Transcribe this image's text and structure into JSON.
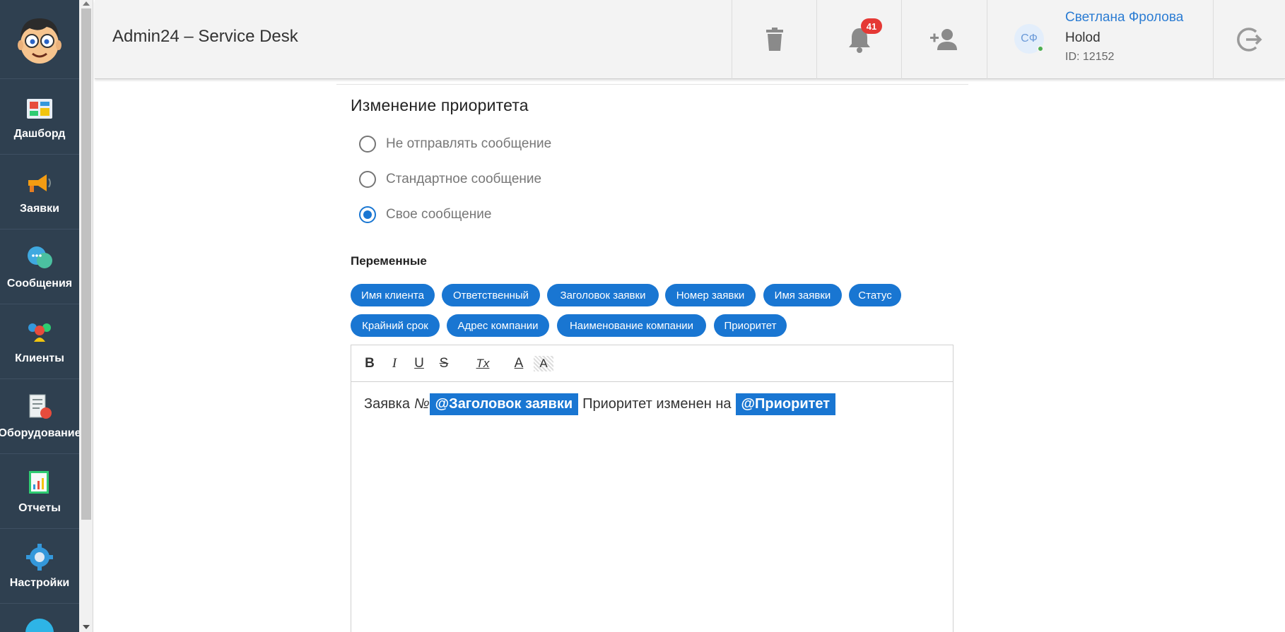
{
  "header": {
    "app_title": "Admin24 – Service Desk",
    "notification_count": "41",
    "user": {
      "initials": "СФ",
      "name": "Светлана Фролова",
      "org": "Holod",
      "id": "ID: 12152"
    }
  },
  "sidebar": {
    "items": [
      {
        "label": "Дашборд",
        "icon": "dashboard-icon"
      },
      {
        "label": "Заявки",
        "icon": "megaphone-icon"
      },
      {
        "label": "Сообщения",
        "icon": "chat-icon"
      },
      {
        "label": "Клиенты",
        "icon": "clients-icon"
      },
      {
        "label": "Оборудование",
        "icon": "equipment-icon"
      },
      {
        "label": "Отчеты",
        "icon": "reports-icon"
      },
      {
        "label": "Настройки",
        "icon": "settings-icon"
      }
    ]
  },
  "main": {
    "section_title": "Изменение приоритета",
    "radios": [
      {
        "label": "Не отправлять сообщение",
        "checked": false
      },
      {
        "label": "Стандартное сообщение",
        "checked": false
      },
      {
        "label": "Свое сообщение",
        "checked": true
      }
    ],
    "variables_title": "Переменные",
    "variables": [
      "Имя клиента",
      "Ответственный",
      "Заголовок заявки",
      "Номер заявки",
      "Имя заявки",
      "Статус",
      "Крайний срок",
      "Адрес компании",
      "Наименование компании",
      "Приоритет"
    ],
    "editor": {
      "toolbar": {
        "bold": "B",
        "italic": "I",
        "underline": "U",
        "strike": "S",
        "clear_format": "Tx",
        "text_color": "A",
        "bg_color": "A"
      },
      "text_prefix": "Заявка ",
      "text_number_sign": "№",
      "tag_1": "@Заголовок заявки",
      "text_middle": "Приоритет изменен на",
      "tag_2": "@Приоритет"
    }
  },
  "colors": {
    "sidebar_bg": "#2f4050",
    "accent": "#1976d2",
    "badge": "#e53935"
  }
}
